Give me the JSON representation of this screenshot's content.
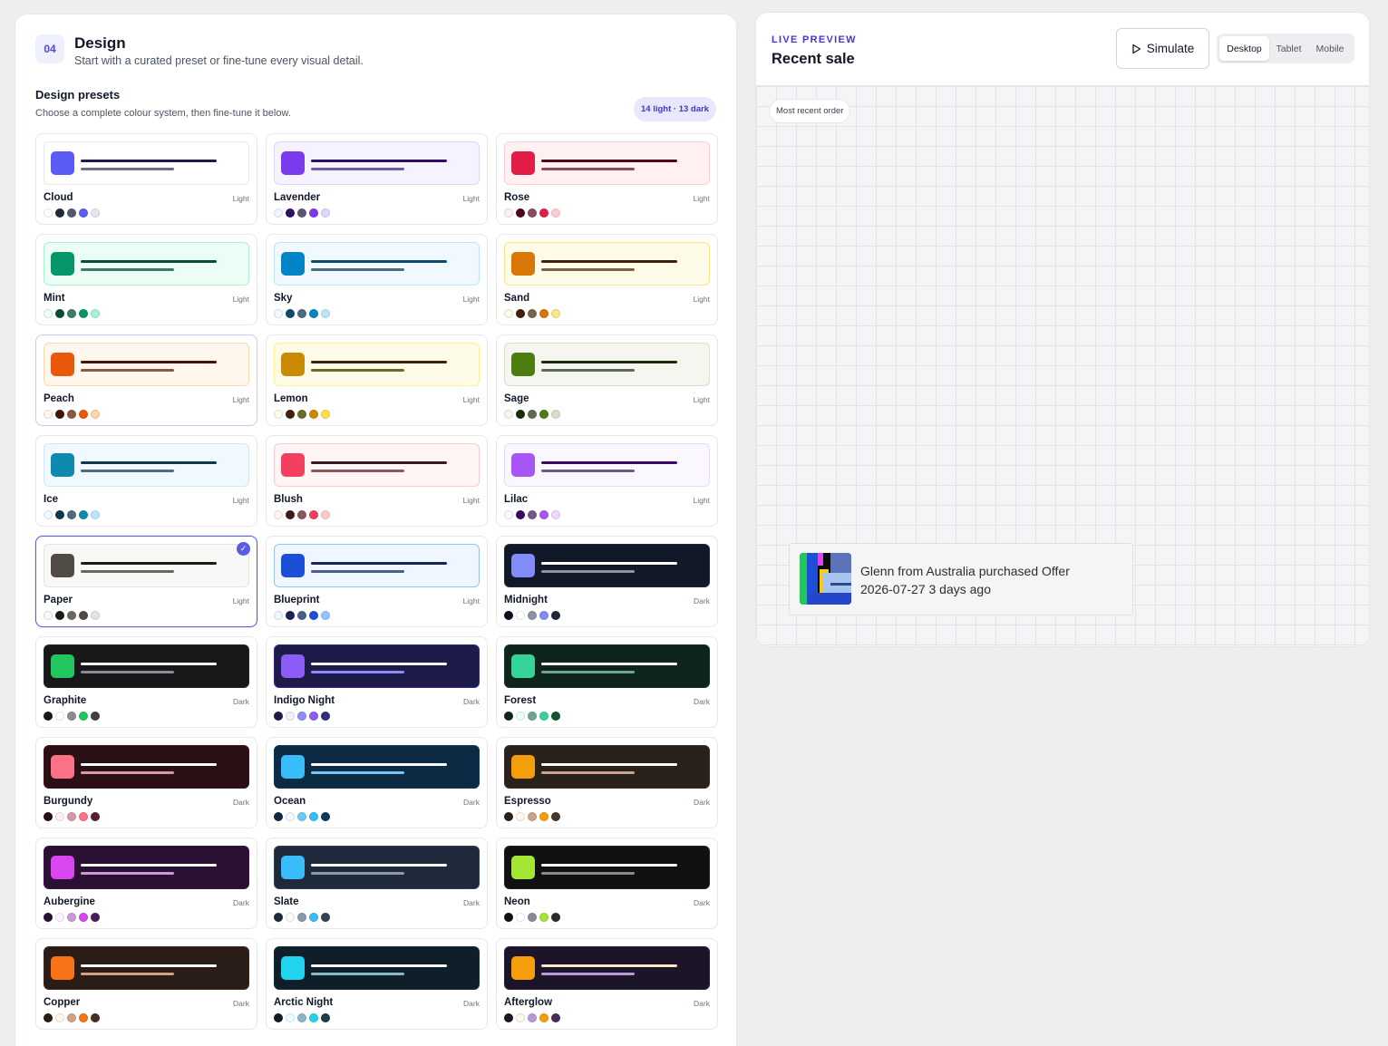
{
  "design": {
    "step": "04",
    "title": "Design",
    "subtitle": "Start with a curated preset or fine-tune every visual detail.",
    "presets_title": "Design presets",
    "presets_subtitle": "Choose a complete colour system, then fine-tune it below.",
    "count_label": "14 light · 13 dark",
    "selected_preset": "Paper"
  },
  "presets": [
    {
      "name": "Cloud",
      "mode": "Light",
      "bg": "#ffffff",
      "border": "#e5e7eb",
      "accent": "#5b5cf6",
      "line1": "#1e1b4b",
      "line2": "#6b6f86",
      "dots": [
        "#ffffff",
        "#1f2937",
        "#525a6b",
        "#5b5cf6",
        "#e5e7eb"
      ]
    },
    {
      "name": "Lavender",
      "mode": "Light",
      "bg": "#f5f3ff",
      "border": "#ddd6fe",
      "accent": "#7c3aed",
      "line1": "#2e1065",
      "line2": "#6f5aa6",
      "dots": [
        "#f5f3ff",
        "#2e1065",
        "#5b5773",
        "#7c3aed",
        "#ddd6fe"
      ]
    },
    {
      "name": "Rose",
      "mode": "Light",
      "bg": "#fff1f2",
      "border": "#fecdd3",
      "accent": "#e11d48",
      "line1": "#4c0519",
      "line2": "#8b4a5e",
      "dots": [
        "#fff1f2",
        "#4c0519",
        "#8b4a5e",
        "#e11d48",
        "#fecdd3"
      ]
    },
    {
      "name": "Mint",
      "mode": "Light",
      "bg": "#ecfdf5",
      "border": "#a7f3d0",
      "accent": "#059669",
      "line1": "#064e3b",
      "line2": "#3f7a66",
      "dots": [
        "#ecfdf5",
        "#064e3b",
        "#3f7a66",
        "#059669",
        "#a7f3d0"
      ]
    },
    {
      "name": "Sky",
      "mode": "Light",
      "bg": "#f0f9ff",
      "border": "#bae6fd",
      "accent": "#0284c7",
      "line1": "#0c4a6e",
      "line2": "#4a6b80",
      "dots": [
        "#f0f9ff",
        "#0c4a6e",
        "#4a6b80",
        "#0284c7",
        "#bae6fd"
      ]
    },
    {
      "name": "Sand",
      "mode": "Light",
      "bg": "#fefce8",
      "border": "#fde68a",
      "accent": "#d97706",
      "line1": "#422006",
      "line2": "#7a6445",
      "dots": [
        "#fefce8",
        "#422006",
        "#7a6445",
        "#d97706",
        "#fde68a"
      ]
    },
    {
      "name": "Peach",
      "mode": "Light",
      "bg": "#fff7ed",
      "border": "#fed7aa",
      "accent": "#ea580c",
      "line1": "#431407",
      "line2": "#8a5a3c",
      "dots": [
        "#fff7ed",
        "#431407",
        "#8a5a3c",
        "#ea580c",
        "#fed7aa"
      ]
    },
    {
      "name": "Lemon",
      "mode": "Light",
      "bg": "#fefce8",
      "border": "#fef08a",
      "accent": "#ca8a04",
      "line1": "#422006",
      "line2": "#6b6a2a",
      "dots": [
        "#fefce8",
        "#422006",
        "#6b6a2a",
        "#ca8a04",
        "#fde047"
      ]
    },
    {
      "name": "Sage",
      "mode": "Light",
      "bg": "#f4f6ef",
      "border": "#d9decd",
      "accent": "#4d7c0f",
      "line1": "#1a2e05",
      "line2": "#5f6b52",
      "dots": [
        "#f4f6ef",
        "#1a2e05",
        "#5f6b52",
        "#4d7c0f",
        "#d9decd"
      ]
    },
    {
      "name": "Ice",
      "mode": "Light",
      "bg": "#f0f9ff",
      "border": "#cfe8f3",
      "accent": "#0e8aaf",
      "line1": "#0c3a4e",
      "line2": "#4f6c7a",
      "dots": [
        "#f0f9ff",
        "#0c3a4e",
        "#4f6c7a",
        "#0e8aaf",
        "#bae6fd"
      ]
    },
    {
      "name": "Blush",
      "mode": "Light",
      "bg": "#fff5f5",
      "border": "#fecaca",
      "accent": "#f43f5e",
      "line1": "#3f1a1a",
      "line2": "#8a5a5a",
      "dots": [
        "#fff5f5",
        "#3f1a1a",
        "#8a5a5a",
        "#f43f5e",
        "#fecaca"
      ]
    },
    {
      "name": "Lilac",
      "mode": "Light",
      "bg": "#fbf7ff",
      "border": "#ead9fd",
      "accent": "#a855f7",
      "line1": "#3b0764",
      "line2": "#6f5a86",
      "dots": [
        "#fbf7ff",
        "#3b0764",
        "#6f5a86",
        "#a855f7",
        "#ead9fd"
      ]
    },
    {
      "name": "Paper",
      "mode": "Light",
      "bg": "#f8f8f6",
      "border": "#e5e5e0",
      "accent": "#504b44",
      "line1": "#1c1917",
      "line2": "#6d685f",
      "dots": [
        "#f8f8f6",
        "#1c1917",
        "#6d685f",
        "#504b44",
        "#e5e5e0"
      ]
    },
    {
      "name": "Blueprint",
      "mode": "Light",
      "bg": "#eff6ff",
      "border": "#93c5fd",
      "accent": "#1d4ed8",
      "line1": "#172554",
      "line2": "#4a5f8a",
      "dots": [
        "#eff6ff",
        "#172554",
        "#4a5f8a",
        "#1d4ed8",
        "#93c5fd"
      ]
    },
    {
      "name": "Midnight",
      "mode": "Dark",
      "bg": "#111827",
      "border": "#1f2937",
      "accent": "#818cf8",
      "line1": "#ffffff",
      "line2": "#8b93a6",
      "dots": [
        "#0b1020",
        "#ffffff",
        "#8b93a6",
        "#818cf8",
        "#1f2937"
      ]
    },
    {
      "name": "Graphite",
      "mode": "Dark",
      "bg": "#18181b",
      "border": "#27272a",
      "accent": "#22c55e",
      "line1": "#ffffff",
      "line2": "#8b8b93",
      "dots": [
        "#18181b",
        "#ffffff",
        "#8b8b93",
        "#22c55e",
        "#3f3f46"
      ]
    },
    {
      "name": "Indigo Night",
      "mode": "Dark",
      "bg": "#1e1b4b",
      "border": "#312e81",
      "accent": "#8b5cf6",
      "line1": "#ffffff",
      "line2": "#8b8df8",
      "dots": [
        "#1e1b4b",
        "#eef0ff",
        "#8b8df8",
        "#8b5cf6",
        "#312e81"
      ]
    },
    {
      "name": "Forest",
      "mode": "Dark",
      "bg": "#0f241c",
      "border": "#14352a",
      "accent": "#34d399",
      "line1": "#ffffff",
      "line2": "#6fa58f",
      "dots": [
        "#0f241c",
        "#ecfdf5",
        "#6fa58f",
        "#34d399",
        "#14532d"
      ]
    },
    {
      "name": "Burgundy",
      "mode": "Dark",
      "bg": "#2a0f14",
      "border": "#3f1520",
      "accent": "#fb7185",
      "line1": "#ffffff",
      "line2": "#d59aa5",
      "dots": [
        "#2a0f14",
        "#fff1f2",
        "#d59aa5",
        "#fb7185",
        "#5a1f2c"
      ]
    },
    {
      "name": "Ocean",
      "mode": "Dark",
      "bg": "#0c2a44",
      "border": "#0f3a5c",
      "accent": "#38bdf8",
      "line1": "#ffffff",
      "line2": "#6fc8f5",
      "dots": [
        "#0c2a44",
        "#f0f9ff",
        "#6fc8f5",
        "#38bdf8",
        "#0f3a5c"
      ]
    },
    {
      "name": "Espresso",
      "mode": "Dark",
      "bg": "#2b211c",
      "border": "#3b2d25",
      "accent": "#f59e0b",
      "line1": "#ffffff",
      "line2": "#c9a48a",
      "dots": [
        "#2b211c",
        "#fff7ed",
        "#c9a48a",
        "#f59e0b",
        "#4a372c"
      ]
    },
    {
      "name": "Aubergine",
      "mode": "Dark",
      "bg": "#2a1033",
      "border": "#3b1547",
      "accent": "#d946ef",
      "line1": "#ffffff",
      "line2": "#c99ad6",
      "dots": [
        "#2a1033",
        "#fdf4ff",
        "#c99ad6",
        "#d946ef",
        "#4a1d59"
      ]
    },
    {
      "name": "Slate",
      "mode": "Dark",
      "bg": "#1e293b",
      "border": "#334155",
      "accent": "#38bdf8",
      "line1": "#ffffff",
      "line2": "#8a98ad",
      "dots": [
        "#1e293b",
        "#f8fafc",
        "#8a98ad",
        "#38bdf8",
        "#334155"
      ]
    },
    {
      "name": "Neon",
      "mode": "Dark",
      "bg": "#111111",
      "border": "#222222",
      "accent": "#a3e635",
      "line1": "#ffffff",
      "line2": "#8a8a94",
      "dots": [
        "#111111",
        "#ffffff",
        "#8a8a94",
        "#a3e635",
        "#2b2b2b"
      ]
    },
    {
      "name": "Copper",
      "mode": "Dark",
      "bg": "#2a1c16",
      "border": "#3b271e",
      "accent": "#f97316",
      "line1": "#ffffff",
      "line2": "#d4a282",
      "dots": [
        "#2a1c16",
        "#fff7ed",
        "#d4a282",
        "#f97316",
        "#4a2e22"
      ]
    },
    {
      "name": "Arctic Night",
      "mode": "Dark",
      "bg": "#0f1f29",
      "border": "#16303d",
      "accent": "#22d3ee",
      "line1": "#ffffff",
      "line2": "#8ab8c8",
      "dots": [
        "#0f1f29",
        "#ecfeff",
        "#8ab8c8",
        "#22d3ee",
        "#1f3a48"
      ]
    },
    {
      "name": "Afterglow",
      "mode": "Dark",
      "bg": "#1c1429",
      "border": "#2b1f3d",
      "accent": "#f59e0b",
      "line1": "#fde8c4",
      "line2": "#b89ad6",
      "dots": [
        "#1c1429",
        "#fff7ed",
        "#b89ad6",
        "#f59e0b",
        "#4a2a5c"
      ]
    }
  ],
  "preview": {
    "eyebrow": "LIVE PREVIEW",
    "title": "Recent sale",
    "simulate_label": "Simulate",
    "devices": [
      "Desktop",
      "Tablet",
      "Mobile"
    ],
    "active_device": "Desktop",
    "canvas_tag": "Most recent order",
    "toast_line1": "Glenn from Australia purchased Offer",
    "toast_line2": "2026-07-27 3 days ago"
  },
  "icons": {
    "play": "play-icon",
    "check": "check-icon"
  }
}
